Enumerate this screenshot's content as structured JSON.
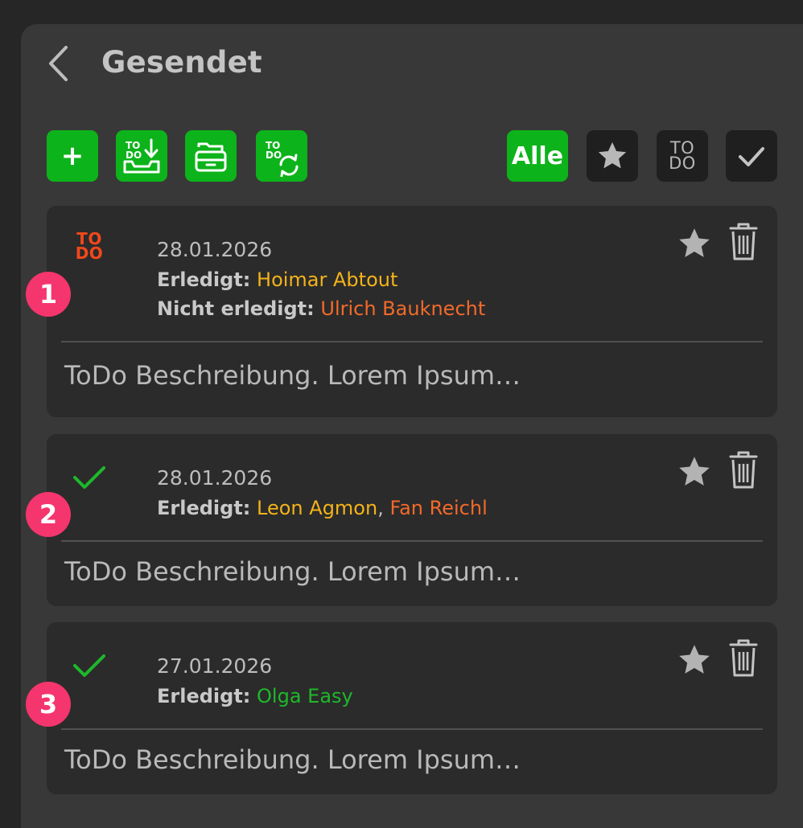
{
  "header": {
    "title": "Gesendet"
  },
  "toolbar": {
    "add_label": "+",
    "todo_small_label": "TO\nDO",
    "filter_all_label": "Alle",
    "filter_todo_label": "TO\nDO"
  },
  "colors": {
    "green": "#0db31a",
    "yellow": "#f3b31a",
    "orange": "#f26a2a",
    "badge": "#f5356d",
    "background": "#383838",
    "card": "#2b2b2b"
  },
  "cards": [
    {
      "badge": "1",
      "status_icon": "todo-icon",
      "status_label": "TO\nDO",
      "date": "28.01.2026",
      "done_label": "Erledigt:",
      "done_names": [
        "Hoimar Abtout"
      ],
      "not_done_label": "Nicht erledigt:",
      "not_done_names": [
        "Ulrich Bauknecht"
      ],
      "description": "ToDo Beschreibung. Lorem Ipsum…"
    },
    {
      "badge": "2",
      "status_icon": "checkmark-icon",
      "date": "28.01.2026",
      "done_label": "Erledigt:",
      "done_names": [
        "Leon Agmon",
        "Fan Reichl"
      ],
      "separator": ",",
      "description": "ToDo Beschreibung. Lorem Ipsum…"
    },
    {
      "badge": "3",
      "status_icon": "checkmark-icon",
      "date": "27.01.2026",
      "done_label": "Erledigt:",
      "done_names": [
        "Olga Easy"
      ],
      "description": "ToDo Beschreibung. Lorem Ipsum…"
    }
  ]
}
